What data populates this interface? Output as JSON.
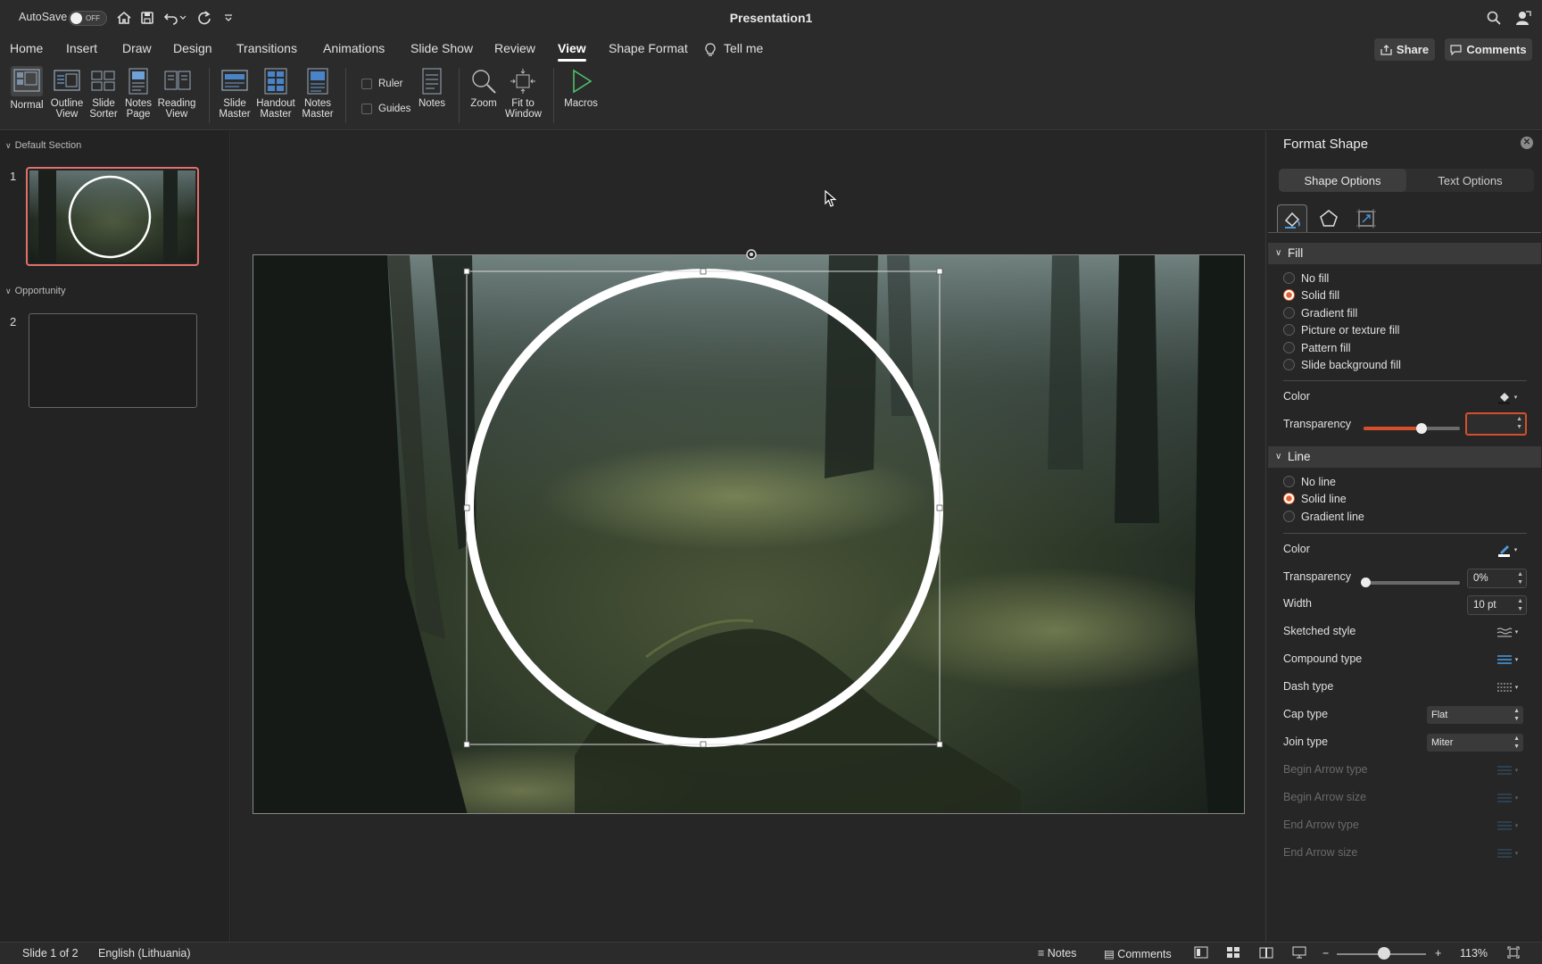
{
  "titlebar": {
    "autosave_label": "AutoSave",
    "autosave_state": "OFF",
    "title": "Presentation1"
  },
  "tabs": [
    "Home",
    "Insert",
    "Draw",
    "Design",
    "Transitions",
    "Animations",
    "Slide Show",
    "Review",
    "View",
    "Shape Format"
  ],
  "active_tab": "View",
  "tell_me": "Tell me",
  "header_buttons": {
    "share": "Share",
    "comments": "Comments"
  },
  "ribbon": {
    "normal": "Normal",
    "outline_view": [
      "Outline",
      "View"
    ],
    "slide_sorter": [
      "Slide",
      "Sorter"
    ],
    "notes_page": [
      "Notes",
      "Page"
    ],
    "reading_view": [
      "Reading",
      "View"
    ],
    "slide_master": [
      "Slide",
      "Master"
    ],
    "handout_master": [
      "Handout",
      "Master"
    ],
    "notes_master": [
      "Notes",
      "Master"
    ],
    "ruler": "Ruler",
    "guides": "Guides",
    "notes": "Notes",
    "zoom": "Zoom",
    "fit_to_window": [
      "Fit to",
      "Window"
    ],
    "macros": "Macros"
  },
  "slides_panel": {
    "sections": [
      "Default Section",
      "Opportunity"
    ],
    "slides": [
      "1",
      "2"
    ]
  },
  "format_pane": {
    "title": "Format Shape",
    "tabs": [
      "Shape Options",
      "Text Options"
    ],
    "fill": {
      "header": "Fill",
      "options": [
        "No fill",
        "Solid fill",
        "Gradient fill",
        "Picture or texture fill",
        "Pattern fill",
        "Slide background fill"
      ],
      "selected": "Solid fill",
      "color_label": "Color",
      "transparency_label": "Transparency",
      "transparency_value": 0.6,
      "transparency_text": ""
    },
    "line": {
      "header": "Line",
      "options": [
        "No line",
        "Solid line",
        "Gradient line"
      ],
      "selected": "Solid line",
      "color_label": "Color",
      "transparency_label": "Transparency",
      "transparency_text": "0%",
      "width_label": "Width",
      "width_value": "10 pt",
      "sketched_label": "Sketched style",
      "compound_label": "Compound type",
      "dash_label": "Dash type",
      "cap_label": "Cap type",
      "cap_value": "Flat",
      "join_label": "Join type",
      "join_value": "Miter",
      "begin_arrow_type": "Begin Arrow type",
      "begin_arrow_size": "Begin Arrow size",
      "end_arrow_type": "End Arrow type",
      "end_arrow_size": "End Arrow size"
    }
  },
  "status": {
    "slide_count": "Slide 1 of 2",
    "language": "English (Lithuania)",
    "notes": "Notes",
    "comments": "Comments",
    "zoom": "113%"
  },
  "colors": {
    "accent": "#d4502c",
    "selection": "#e2706a"
  }
}
